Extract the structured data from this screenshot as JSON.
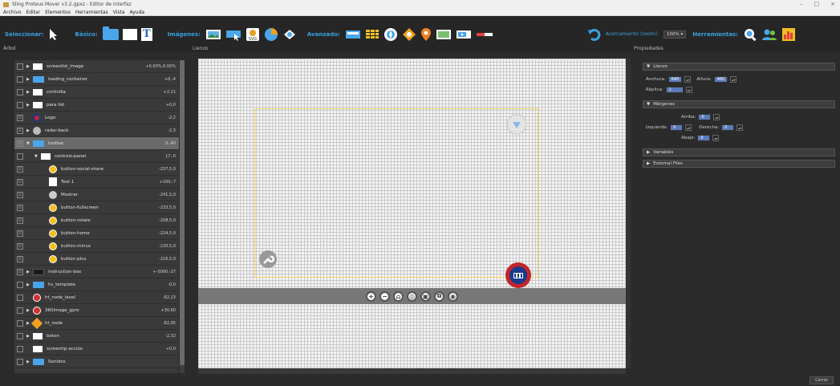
{
  "window": {
    "title": "Sling Proteus Mover v3.2.gpxz - Editor de interfaz",
    "min": "–",
    "max": "□",
    "close": "×"
  },
  "menu": [
    "Archivo",
    "Editar",
    "Elementos",
    "Herramientas",
    "Vista",
    "Ayuda"
  ],
  "toolbar": {
    "select_label": "Seleccionar:",
    "basic_label": "Básico:",
    "images_label": "Imágenes:",
    "advanced_label": "Avanzado:",
    "zoom_label": "Acercamiento (zoom):",
    "zoom_value": "100% ▾",
    "tools_label": "Herramientas:",
    "text_tool": "T"
  },
  "panels": {
    "tree_title": "Árbol",
    "canvas_title": "Lienzo",
    "props_title": "Propiedades"
  },
  "tree_rows": [
    {
      "name": "screenlist_image",
      "value": "+0.00%,0.00%",
      "arrow": "▶",
      "icon": "white",
      "indent": 0,
      "chk": ""
    },
    {
      "name": "loading_container",
      "value": "+0,-4",
      "arrow": "▶",
      "icon": "folder",
      "indent": 0,
      "chk": ""
    },
    {
      "name": "cortinilla",
      "value": "+2,11",
      "arrow": "▶",
      "icon": "white",
      "indent": 0,
      "chk": ""
    },
    {
      "name": "para list",
      "value": "+0,0",
      "arrow": "▶",
      "icon": "white",
      "indent": 0,
      "chk": ""
    },
    {
      "name": "Logo",
      "value": "-2,2",
      "arrow": "",
      "icon": "logo",
      "indent": 0,
      "chk": "☑"
    },
    {
      "name": "radar-back",
      "value": "-2,3",
      "arrow": "▶",
      "icon": "gray",
      "indent": 0,
      "chk": "☑"
    },
    {
      "name": "toolbar",
      "value": "0,-40",
      "arrow": "▼",
      "icon": "folder",
      "indent": 0,
      "chk": "☑",
      "selected": true
    },
    {
      "name": "controls-panel",
      "value": "17,-0",
      "arrow": "▼",
      "icon": "white",
      "indent": 1,
      "chk": ""
    },
    {
      "name": "button-social-share",
      "value": "-237,5,0",
      "arrow": "",
      "icon": "yellow",
      "indent": 2,
      "chk": "☑"
    },
    {
      "name": "Text 1",
      "value": "+100,-7",
      "arrow": "",
      "icon": "text",
      "indent": 2,
      "chk": "☑"
    },
    {
      "name": "Mostrar",
      "value": "-241,5,0",
      "arrow": "",
      "icon": "pin",
      "indent": 2,
      "chk": "☑"
    },
    {
      "name": "button-fullscreen",
      "value": "-233,5,0",
      "arrow": "",
      "icon": "yellow",
      "indent": 2,
      "chk": "☑"
    },
    {
      "name": "button-rotate",
      "value": "-208,5,0",
      "arrow": "",
      "icon": "yellow",
      "indent": 2,
      "chk": "☑"
    },
    {
      "name": "button-home",
      "value": "-224,5,0",
      "arrow": "",
      "icon": "yellow",
      "indent": 2,
      "chk": "☑"
    },
    {
      "name": "button-minus",
      "value": "-220,5,0",
      "arrow": "",
      "icon": "yellow",
      "indent": 2,
      "chk": "☑"
    },
    {
      "name": "button-plus",
      "value": "-216,5,0",
      "arrow": "",
      "icon": "yellow",
      "indent": 2,
      "chk": "☑"
    },
    {
      "name": "instruction-box",
      "value": "+-5000,-27",
      "arrow": "▶",
      "icon": "dark",
      "indent": 0,
      "chk": "☑"
    },
    {
      "name": "hs_template",
      "value": "-0,0",
      "arrow": "▶",
      "icon": "folder",
      "indent": 0,
      "chk": ""
    },
    {
      "name": "ht_node_level",
      "value": "-82,23",
      "arrow": "",
      "icon": "red",
      "indent": 0,
      "chk": ""
    },
    {
      "name": "360image_gyro",
      "value": "+30,60",
      "arrow": "▶",
      "icon": "red",
      "indent": 0,
      "chk": ""
    },
    {
      "name": "ht_node",
      "value": "-82,95",
      "arrow": "▶",
      "icon": "orange",
      "indent": 0,
      "chk": ""
    },
    {
      "name": "boton",
      "value": "-2,32",
      "arrow": "▶",
      "icon": "white",
      "indent": 0,
      "chk": ""
    },
    {
      "name": "screentip-acción",
      "value": "+0,0",
      "arrow": "",
      "icon": "white",
      "indent": 0,
      "chk": ""
    },
    {
      "name": "Sonidos",
      "value": "",
      "arrow": "▶",
      "icon": "folder",
      "indent": 0,
      "chk": ""
    }
  ],
  "canvas": {
    "bottom_controls": [
      "+",
      "−",
      "⌂",
      "◎",
      "▣",
      "⧉",
      "◉"
    ]
  },
  "props": {
    "lienzo": "Lienzo",
    "width_label": "Anchura:",
    "width_value": "640",
    "height_label": "Altura:",
    "height_value": "480",
    "replica_label": "Réplica:",
    "replica_value": "1",
    "margins": "Márgenes",
    "top_label": "Arriba:",
    "top_value": "0",
    "left_label": "Izquierda:",
    "left_value": "0",
    "right_label": "Derecha:",
    "right_value": "0",
    "bottom_label": "Abajo:",
    "bottom_value": "0",
    "variables": "Variables",
    "external_files": "External Files",
    "spin_arrows": "▴▾"
  },
  "status": {
    "close_label": "Cerrar"
  },
  "colors": {
    "accent": "#3aa0e0",
    "folder": "#4aa6ea",
    "selected_row": "#6a6a6a"
  }
}
